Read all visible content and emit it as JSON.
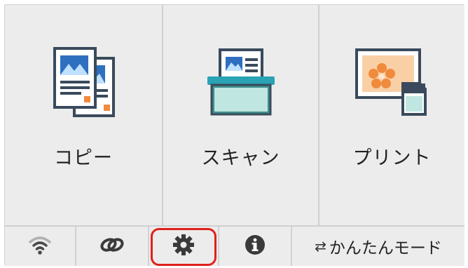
{
  "tiles": [
    {
      "label": "コピー",
      "icon": "copy-icon"
    },
    {
      "label": "スキャン",
      "icon": "scan-icon"
    },
    {
      "label": "プリント",
      "icon": "print-icon"
    }
  ],
  "bottom_bar": {
    "wifi_icon": "wifi-icon",
    "link_icon": "link-icon",
    "settings_icon": "gear-icon",
    "info_icon": "info-icon",
    "easy_mode_arrow": "⇄",
    "easy_mode_label": "かんたんモード"
  },
  "colors": {
    "panel_bg": "#ececec",
    "highlight": "#e0201a",
    "icon_dark": "#3a4a5c",
    "icon_blue": "#2f6fbf",
    "scan_teal": "#2aa3b5",
    "print_orange": "#f08a3c"
  }
}
